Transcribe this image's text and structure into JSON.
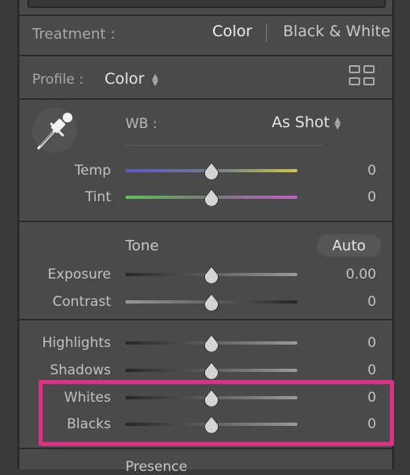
{
  "treatment": {
    "label": "Treatment :",
    "options": [
      "Color",
      "Black & White"
    ],
    "selected": "Color"
  },
  "profile": {
    "label": "Profile :",
    "value": "Color"
  },
  "white_balance": {
    "label": "WB :",
    "value": "As Shot"
  },
  "wb_sliders": [
    {
      "name": "Temp",
      "value": "0",
      "level": 0.5
    },
    {
      "name": "Tint",
      "value": "0",
      "level": 0.5
    }
  ],
  "tone": {
    "title": "Tone",
    "auto_label": "Auto",
    "sliders": [
      {
        "name": "Exposure",
        "value": "0.00",
        "level": 0.5
      },
      {
        "name": "Contrast",
        "value": "0",
        "level": 0.5
      },
      {
        "name": "Highlights",
        "value": "0",
        "level": 0.5
      },
      {
        "name": "Shadows",
        "value": "0",
        "level": 0.5
      },
      {
        "name": "Whites",
        "value": "0",
        "level": 0.5
      },
      {
        "name": "Blacks",
        "value": "0",
        "level": 0.5
      }
    ]
  },
  "presence": {
    "title": "Presence"
  },
  "colors": {
    "highlight": "#e02f86",
    "panel": "#4a4a4a"
  }
}
